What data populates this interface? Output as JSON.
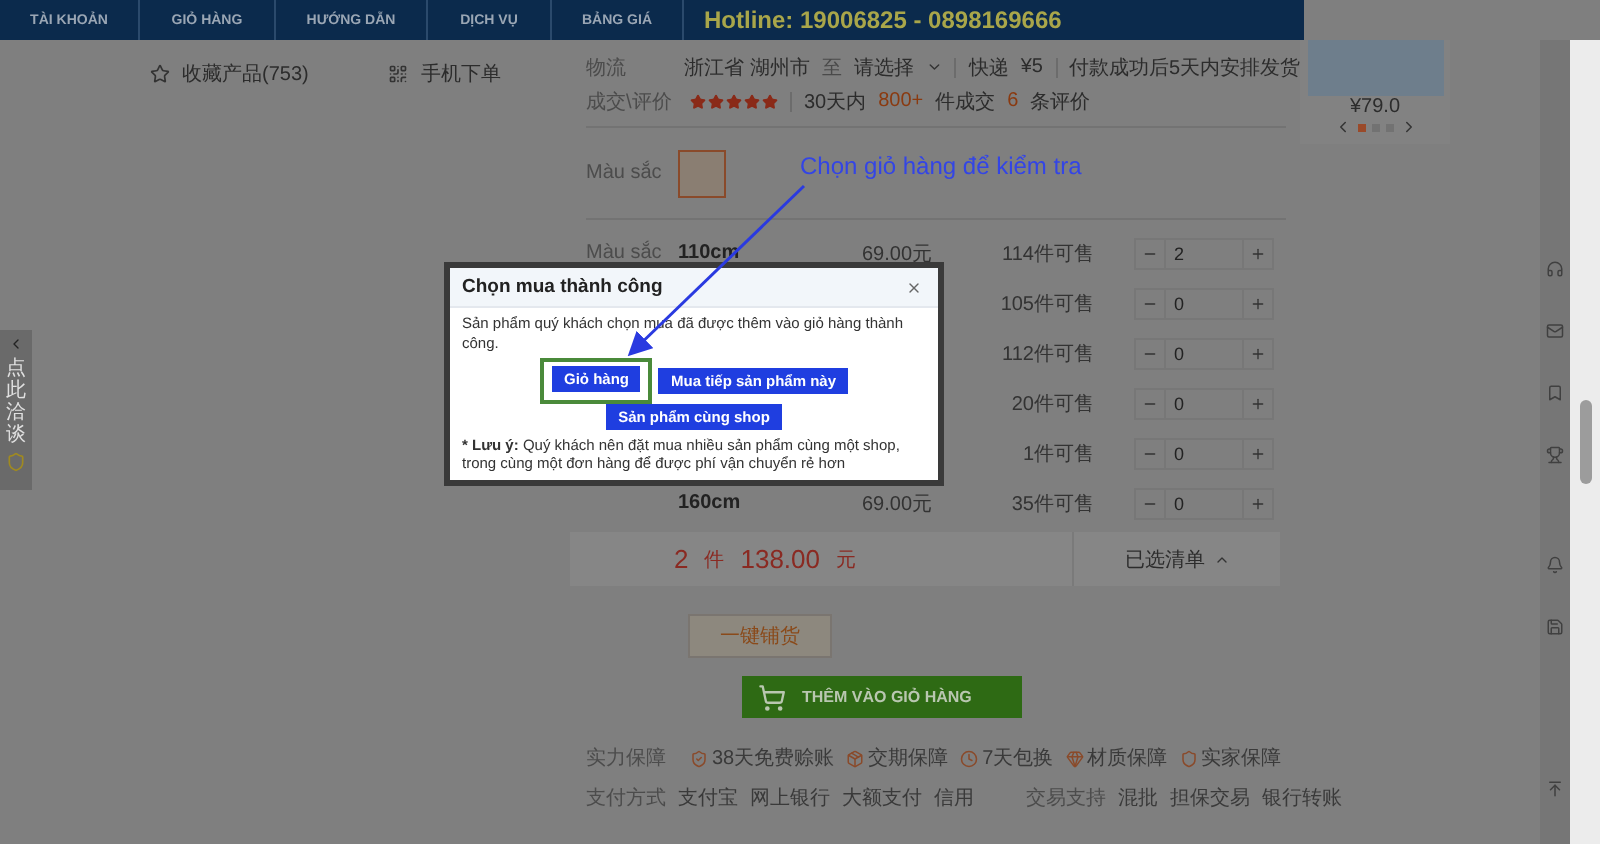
{
  "nav": {
    "items": [
      {
        "label": "TÀI KHOẢN"
      },
      {
        "label": "GIỎ HÀNG"
      },
      {
        "label": "HƯỚNG DẪN"
      },
      {
        "label": "DỊCH VỤ"
      },
      {
        "label": "BẢNG GIÁ"
      }
    ],
    "hotline": "Hotline: 19006825 - 0898169666"
  },
  "left_bar": {
    "favorites": "收藏产品(753)",
    "mobile_order": "手机下单"
  },
  "side_tab": {
    "text": "点此洽谈"
  },
  "logistics": {
    "label": "物流",
    "origin": "浙江省 湖州市",
    "to": "至",
    "destination": "请选择",
    "method": "快递",
    "fee": "¥5",
    "shipping_note": "付款成功后5天内安排发货"
  },
  "deals": {
    "label": "成交\\评价",
    "stars": 5,
    "period": "30天内",
    "count": "800+",
    "count_suffix": "件成交",
    "reviews": "6",
    "reviews_suffix": "条评价"
  },
  "color_option": {
    "label": "Màu sắc"
  },
  "sizes": {
    "label": "Màu sắc",
    "rows": [
      {
        "size": "110cm",
        "price": "69.00元",
        "stock": "114件可售",
        "qty": "2"
      },
      {
        "stock": "105件可售",
        "qty": "0"
      },
      {
        "stock": "112件可售",
        "qty": "0"
      },
      {
        "stock": "20件可售",
        "qty": "0"
      },
      {
        "stock": "1件可售",
        "qty": "0"
      },
      {
        "size": "160cm",
        "price": "69.00元",
        "stock": "35件可售",
        "qty": "0"
      }
    ]
  },
  "summary": {
    "count": "2",
    "count_unit": "件",
    "total": "138.00",
    "currency": "元",
    "selected_list": "已选清单"
  },
  "buttons": {
    "distribute": "一键铺货",
    "add_to_cart": "THÊM VÀO GIỎ HÀNG"
  },
  "guarantees": {
    "label": "实力保障",
    "items": [
      "38天免费赊账",
      "交期保障",
      "7天包换",
      "材质保障",
      "实家保障"
    ]
  },
  "payment": {
    "label": "支付方式",
    "methods": [
      "支付宝",
      "网上银行",
      "大额支付",
      "信用"
    ],
    "trade_label": "交易支持",
    "trade_items": [
      "混批",
      "担保交易",
      "银行转账"
    ]
  },
  "product_card": {
    "price": "¥79.0",
    "pages": [
      {
        "selected": true
      },
      {
        "selected": false
      },
      {
        "selected": false
      }
    ]
  },
  "dialog": {
    "title": "Chọn mua thành công",
    "message": "Sản phẩm quý khách chọn mua đã được thêm vào giỏ hàng thành công.",
    "buttons": [
      {
        "label": "Giỏ hàng",
        "highlighted": true
      },
      {
        "label": "Mua tiếp sản phẩm này",
        "highlighted": false
      },
      {
        "label": "Sản phẩm cùng shop",
        "highlighted": false
      }
    ],
    "note_label": "* Lưu ý:",
    "note": "Quý khách nên đặt mua nhiều sản phẩm cùng một shop, trong cùng một đơn hàng để được phí vận chuyển rẻ hơn"
  },
  "annotation": {
    "text": "Chọn giỏ hàng để kiểm tra"
  }
}
